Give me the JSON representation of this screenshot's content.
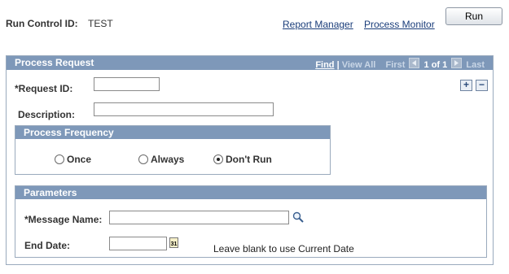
{
  "header": {
    "run_control_label": "Run Control ID:",
    "run_control_value": "TEST",
    "report_manager": "Report Manager",
    "process_monitor": "Process Monitor",
    "run_button": "Run"
  },
  "process_request": {
    "title": "Process Request",
    "nav": {
      "find": "Find",
      "view_all": "View All",
      "first": "First",
      "count": "1 of 1",
      "last": "Last"
    },
    "request_id_label": "*Request ID:",
    "request_id_value": "",
    "description_label": "Description:",
    "description_value": "",
    "add_row": "+",
    "delete_row": "−"
  },
  "frequency": {
    "title": "Process Frequency",
    "options": [
      "Once",
      "Always",
      "Don't Run"
    ],
    "selected": "Don't Run"
  },
  "parameters": {
    "title": "Parameters",
    "message_name_label": "*Message Name:",
    "message_name_value": "",
    "end_date_label": "End Date:",
    "end_date_value": "",
    "end_date_hint": "Leave blank to use Current Date",
    "calendar_icon_text": "31"
  }
}
